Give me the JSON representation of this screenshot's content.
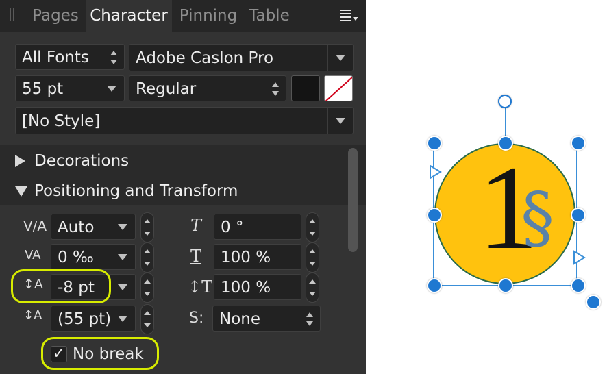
{
  "tabs": [
    {
      "label": "Pages"
    },
    {
      "label": "Character"
    },
    {
      "label": "Pinning"
    },
    {
      "label": "Table"
    }
  ],
  "font": {
    "collection": "All Fonts",
    "family": "Adobe Caslon Pro",
    "size": "55 pt",
    "weight": "Regular",
    "style": "[No Style]"
  },
  "colors": {
    "text_fill": "#141414",
    "stroke": "none",
    "circle_fill": "#ffc20e",
    "circle_stroke": "#2a6b4a",
    "selection": "#1f78d1",
    "highlight": "#d7ec00"
  },
  "sections": {
    "decorations": "Decorations",
    "positioning": "Positioning and Transform"
  },
  "positioning": {
    "kerning": "Auto",
    "tracking": "0 ‰",
    "baseline_shift": "-8 pt",
    "leading": "(55 pt)",
    "shear": "0 °",
    "horizontal_scale": "100 %",
    "vertical_scale": "100 %",
    "typography": "None",
    "no_break_label": "No break",
    "no_break_checked": true
  },
  "canvas": {
    "digit": "1",
    "symbol": "§"
  }
}
